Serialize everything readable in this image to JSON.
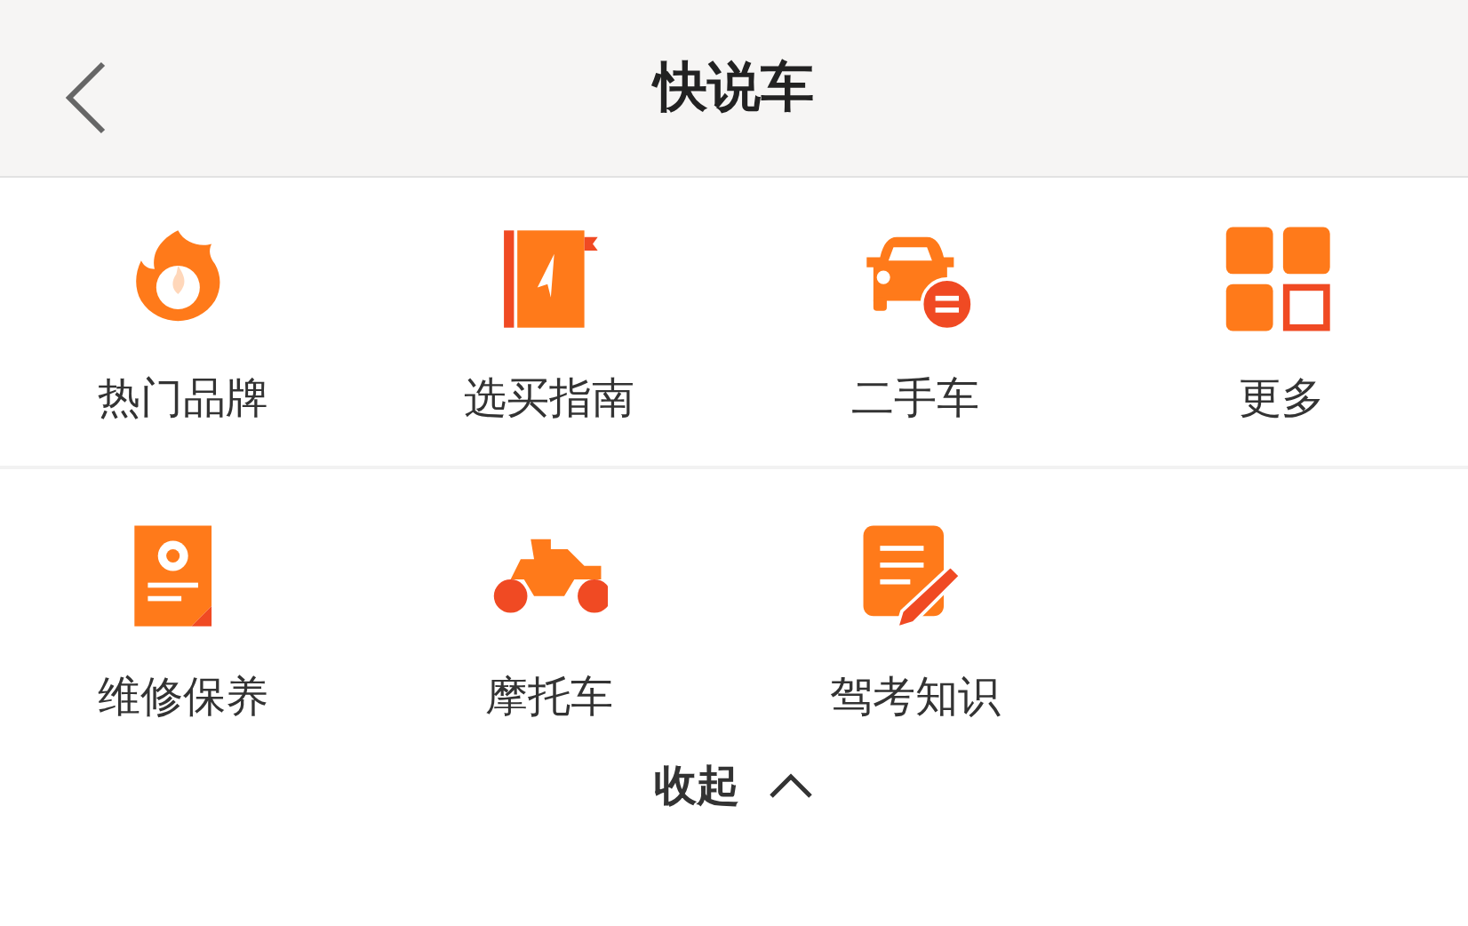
{
  "header": {
    "title": "快说车"
  },
  "rows": [
    {
      "items": [
        {
          "label": "热门品牌",
          "kind": "flame"
        },
        {
          "label": "选买指南",
          "kind": "book"
        },
        {
          "label": "二手车",
          "kind": "car"
        },
        {
          "label": "更多",
          "kind": "grid"
        }
      ]
    },
    {
      "items": [
        {
          "label": "维修保养",
          "kind": "doc"
        },
        {
          "label": "摩托车",
          "kind": "moto"
        },
        {
          "label": "驾考知识",
          "kind": "note"
        }
      ]
    }
  ],
  "collapse": {
    "label": "收起"
  }
}
